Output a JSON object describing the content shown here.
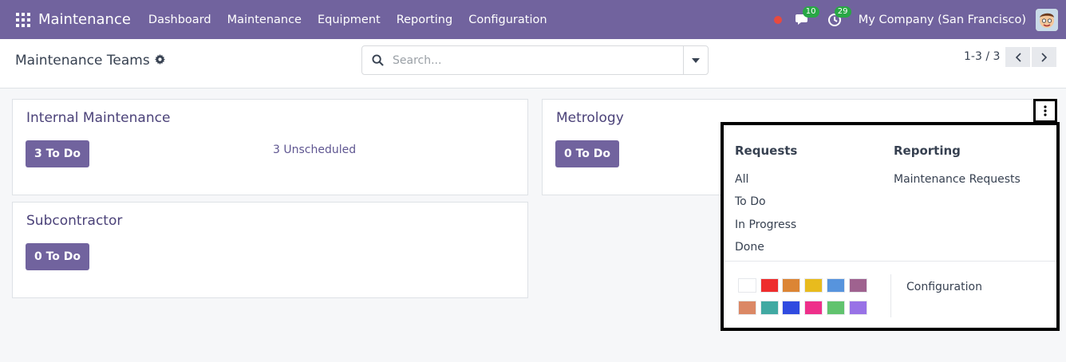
{
  "navbar": {
    "app_name": "Maintenance",
    "menu": [
      "Dashboard",
      "Maintenance",
      "Equipment",
      "Reporting",
      "Configuration"
    ],
    "messages_count": "10",
    "activities_count": "29",
    "company": "My Company (San Francisco)",
    "icons": [
      "apps-grid-icon",
      "recording-dot-icon",
      "chat-icon",
      "clock-icon",
      "avatar"
    ]
  },
  "control": {
    "title": "Maintenance Teams",
    "search_placeholder": "Search...",
    "pager": "1-3 / 3"
  },
  "cards": [
    {
      "title": "Internal Maintenance",
      "todo": "3 To Do",
      "unscheduled": "3 Unscheduled"
    },
    {
      "title": "Metrology",
      "todo": "0 To Do"
    },
    {
      "title": "Subcontractor",
      "todo": "0 To Do"
    }
  ],
  "dropdown": {
    "requests_heading": "Requests",
    "requests_items": [
      "All",
      "To Do",
      "In Progress",
      "Done"
    ],
    "reporting_heading": "Reporting",
    "reporting_items": [
      "Maintenance Requests"
    ],
    "configuration": "Configuration",
    "colors": [
      "#ffffff",
      "#ee2d2d",
      "#dc8534",
      "#e8bb1d",
      "#5794dd",
      "#9f628f",
      "#db8865",
      "#41a9a2",
      "#304be0",
      "#ee2f8a",
      "#61c36e",
      "#9872e6"
    ]
  },
  "colors": {
    "brand": "#71639e",
    "badge": "#28a745",
    "record": "#e84a3f"
  }
}
